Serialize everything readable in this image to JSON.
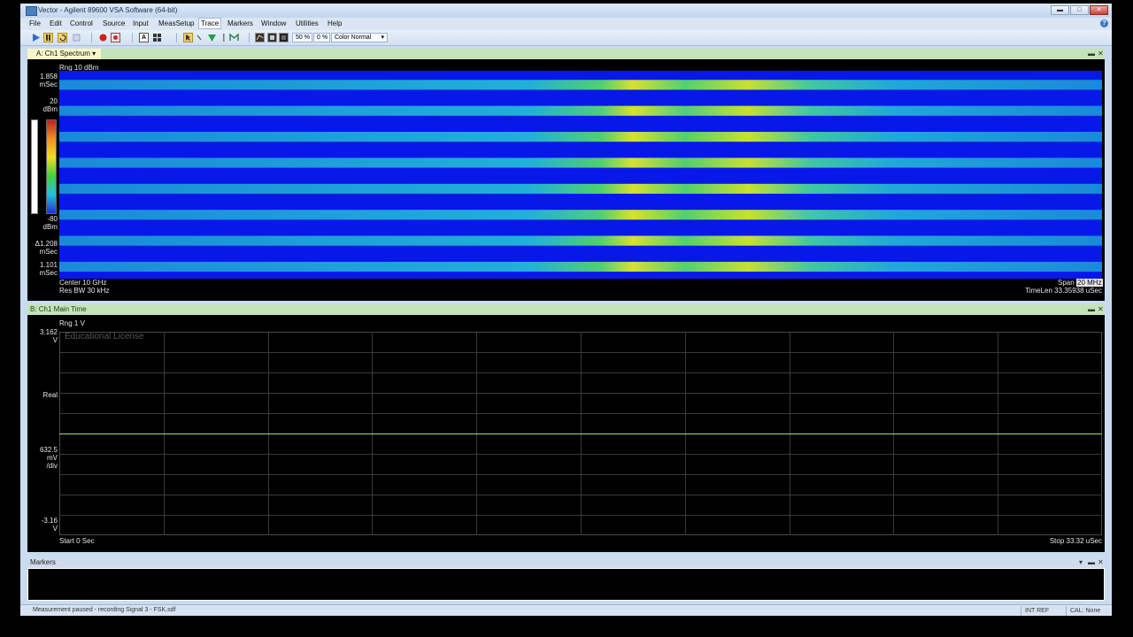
{
  "window": {
    "title": "Vector - Agilent 89600 VSA Software (64-bit)",
    "minimize": "▬",
    "maximize": "□",
    "close": "✕"
  },
  "menu": [
    "File",
    "Edit",
    "Control",
    "Source",
    "Input",
    "MeasSetup",
    "Trace",
    "Markers",
    "Window",
    "Utilities",
    "Help"
  ],
  "toolbar": {
    "percent1": "50 %",
    "percent2": "0 %",
    "color_mode": "Color Normal"
  },
  "panel_a": {
    "tab": "A: Ch1 Spectrum",
    "range": "Rng 10 dBm",
    "time_top_value": "1.858",
    "time_top_unit": "mSec",
    "scale_top_value": "20",
    "scale_top_unit": "dBm",
    "scale_bottom_value": "-80",
    "scale_bottom_unit": "dBm",
    "delta_value": "Δ1.208",
    "delta_unit": "mSec",
    "time_bottom_value": "1.101",
    "time_bottom_unit": "mSec",
    "center": "Center 10 GHz",
    "res_bw": "Res BW 30 kHz",
    "span_label": "Span",
    "span_value": "20 MHz",
    "timelen": "TimeLen 33.35938 uSec"
  },
  "panel_b": {
    "tab": "B: Ch1 Main Time",
    "range": "Rng 1  V",
    "watermark": "Educational License",
    "y_top_value": "3.162",
    "y_top_unit": "V",
    "format": "Real",
    "div_value": "632.5",
    "div_unit1": "mV",
    "div_unit2": "/div",
    "y_bottom_value": "-3.16",
    "y_bottom_unit": "V",
    "start": "Start 0  Sec",
    "stop": "Stop 33.32 uSec"
  },
  "markers_panel": {
    "title": "Markers"
  },
  "status": {
    "message": "Measurement paused - recording Signal 3 - FSK.sdf",
    "ref": "INT REF",
    "cal": "CAL: None"
  },
  "colors": {
    "spectrogram_band": "#1e8fe0",
    "trace": "#9be07a",
    "panel_head": "#c4e3b8",
    "tab_active": "#f8f6c8"
  }
}
